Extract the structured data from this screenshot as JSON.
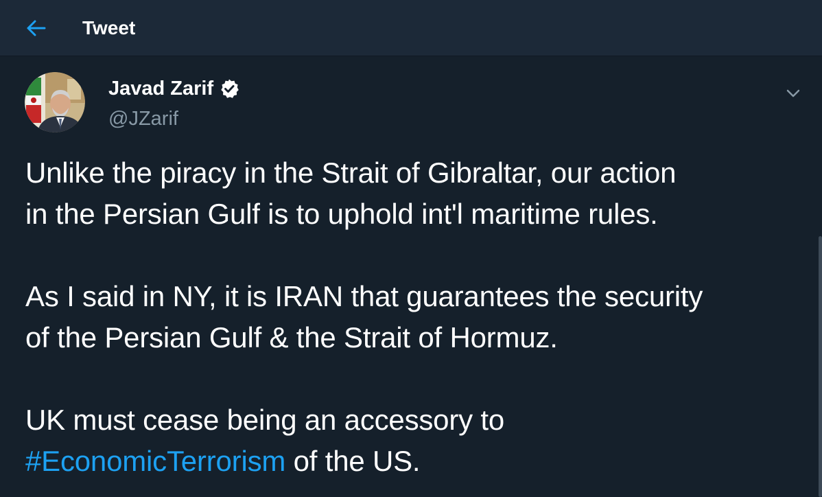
{
  "header": {
    "back_icon": "arrow-left-icon",
    "title": "Tweet"
  },
  "author": {
    "name": "Javad Zarif",
    "handle": "@JZarif",
    "verified_icon": "verified-badge-icon",
    "avatar_icon": "profile-photo"
  },
  "menu": {
    "caret_icon": "chevron-down-icon"
  },
  "tweet": {
    "line1": "Unlike the piracy in the Strait of Gibraltar, our action",
    "line2": "in the Persian Gulf is to uphold int'l maritime rules.",
    "line3": "As I said in NY, it is IRAN that guarantees the security",
    "line4": "of the Persian Gulf & the Strait of Hormuz.",
    "line5": "UK must cease being an accessory to",
    "hashtag": "#EconomicTerrorism",
    "line6_rest": " of the US."
  },
  "colors": {
    "background": "#15202b",
    "header_bg": "#1c2938",
    "accent": "#1da1f2",
    "secondary_text": "#8899a6"
  }
}
